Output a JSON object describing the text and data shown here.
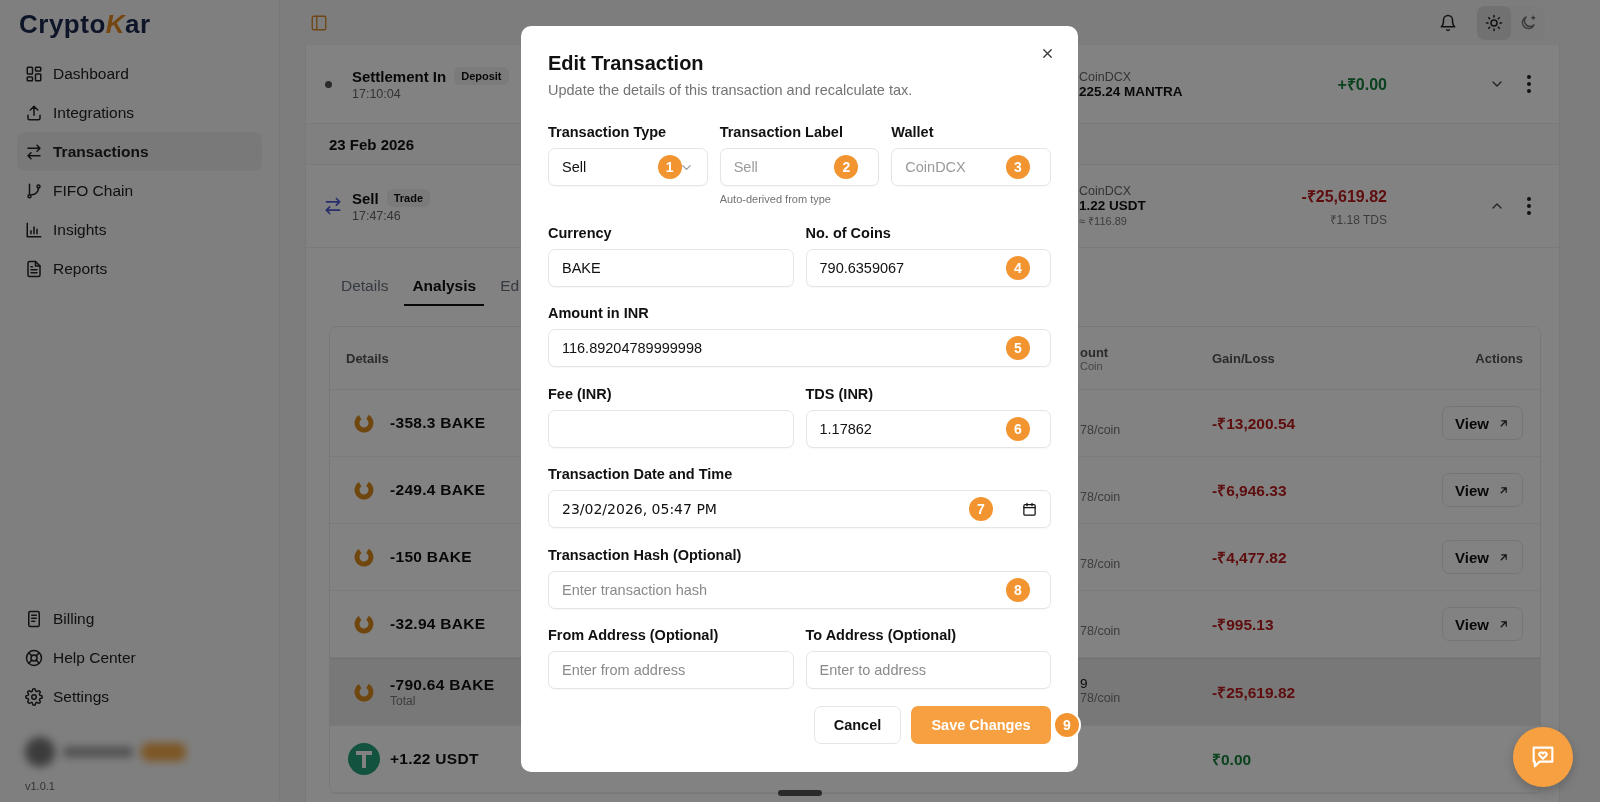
{
  "sidebar": {
    "logo": {
      "before": "Crypto",
      "accent": "K",
      "after": "ar"
    },
    "nav_items": [
      {
        "label": "Dashboard",
        "selected": false
      },
      {
        "label": "Integrations",
        "selected": false
      },
      {
        "label": "Transactions",
        "selected": true
      },
      {
        "label": "FIFO Chain",
        "selected": false
      },
      {
        "label": "Insights",
        "selected": false
      },
      {
        "label": "Reports",
        "selected": false
      }
    ],
    "footer_items": [
      {
        "label": "Billing",
        "selected": false
      },
      {
        "label": "Help Center",
        "selected": false
      },
      {
        "label": "Settings",
        "selected": false
      }
    ],
    "version": "v1.0.1"
  },
  "header": {
    "theme_options": [
      {
        "kind": "light",
        "selected": true
      },
      {
        "kind": "dark",
        "selected": false
      }
    ]
  },
  "transaction_list": [
    {
      "kind": "deposit",
      "title": "Settlement In",
      "tag": "Deposit",
      "time": "17:10:04",
      "wallet": "CoinDCX",
      "asset": "225.24 MANTRA",
      "amount": "+₹0.00",
      "gain": true,
      "expanded": false
    },
    {
      "kind": "date",
      "label": "23 Feb 2026"
    },
    {
      "kind": "trade",
      "title": "Sell",
      "tag": "Trade",
      "time": "17:47:46",
      "wallet": "CoinDCX",
      "asset": "1.22 USDT",
      "asset_value": "≈ ₹116.89",
      "amount": "-₹25,619.82",
      "gain": false,
      "tds": "₹1.18 TDS",
      "expanded": true
    }
  ],
  "detail_tabs": [
    {
      "label": "Details",
      "selected": false
    },
    {
      "label": "Analysis",
      "selected": true
    },
    {
      "label": "Ed",
      "selected": false
    }
  ],
  "analysis_table": {
    "columns": [
      {
        "label": "Details"
      },
      {
        "label": "ount",
        "sublabel": "Coin"
      },
      {
        "label": "Gain/Loss"
      },
      {
        "label": "Actions"
      }
    ],
    "rows": [
      {
        "kind": "bake",
        "amount": "-358.3 BAKE",
        "per_coin": "78/coin",
        "gain_loss": "-₹13,200.54",
        "gain": false,
        "action": "View",
        "total": false
      },
      {
        "kind": "bake",
        "amount": "-249.4 BAKE",
        "per_coin": "78/coin",
        "gain_loss": "-₹6,946.33",
        "gain": false,
        "action": "View",
        "total": false
      },
      {
        "kind": "bake",
        "amount": "-150 BAKE",
        "per_coin": "78/coin",
        "gain_loss": "-₹4,477.82",
        "gain": false,
        "action": "View",
        "total": false
      },
      {
        "kind": "bake",
        "amount": "-32.94 BAKE",
        "per_coin": "78/coin",
        "gain_loss": "-₹995.13",
        "gain": false,
        "action": "View",
        "total": false
      },
      {
        "kind": "bake",
        "amount": "-790.64 BAKE",
        "note": "Total",
        "partial": "9",
        "per_coin": "78/coin",
        "gain_loss": "-₹25,619.82",
        "gain": false,
        "total": true
      },
      {
        "kind": "usdt",
        "amount": "+1.22 USDT",
        "gain_loss": "₹0.00",
        "gain": true,
        "total": false
      }
    ]
  },
  "modal": {
    "title": "Edit Transaction",
    "subtitle": "Update the details of this transaction and recalculate tax.",
    "field_rows": [
      {
        "fields": [
          {
            "label": "Transaction Type",
            "kind": "select",
            "value": "Sell",
            "marker": "1"
          },
          {
            "label": "Transaction Label",
            "kind": "text",
            "value": "Sell",
            "disabled": true,
            "marker": "2",
            "hint": "Auto-derived from type"
          },
          {
            "label": "Wallet",
            "kind": "text",
            "value": "CoinDCX",
            "disabled": true,
            "marker": "3"
          }
        ]
      },
      {
        "fields": [
          {
            "label": "Currency",
            "kind": "text",
            "value": "BAKE"
          },
          {
            "label": "No. of Coins",
            "kind": "text",
            "value": "790.6359067",
            "marker": "4"
          }
        ]
      },
      {
        "fields": [
          {
            "label": "Amount in INR",
            "kind": "text",
            "value": "116.89204789999998",
            "marker": "5"
          }
        ]
      },
      {
        "fields": [
          {
            "label": "Fee (INR)",
            "kind": "text"
          },
          {
            "label": "TDS (INR)",
            "kind": "text",
            "value": "1.17862",
            "marker": "6"
          }
        ]
      },
      {
        "fields": [
          {
            "label": "Transaction Date and Time",
            "kind": "datetime",
            "value": "23/02/2026, 05:47 PM",
            "marker": "7"
          }
        ]
      },
      {
        "fields": [
          {
            "label": "Transaction Hash (Optional)",
            "kind": "text",
            "placeholder": "Enter transaction hash",
            "marker": "8"
          }
        ]
      },
      {
        "fields": [
          {
            "label": "From Address (Optional)",
            "kind": "text",
            "placeholder": "Enter from address"
          },
          {
            "label": "To Address (Optional)",
            "kind": "text",
            "placeholder": "Enter to address"
          }
        ]
      }
    ],
    "buttons": [
      {
        "label": "Cancel",
        "kind": "secondary"
      },
      {
        "label": "Save Changes",
        "kind": "primary",
        "marker": "9"
      }
    ]
  }
}
